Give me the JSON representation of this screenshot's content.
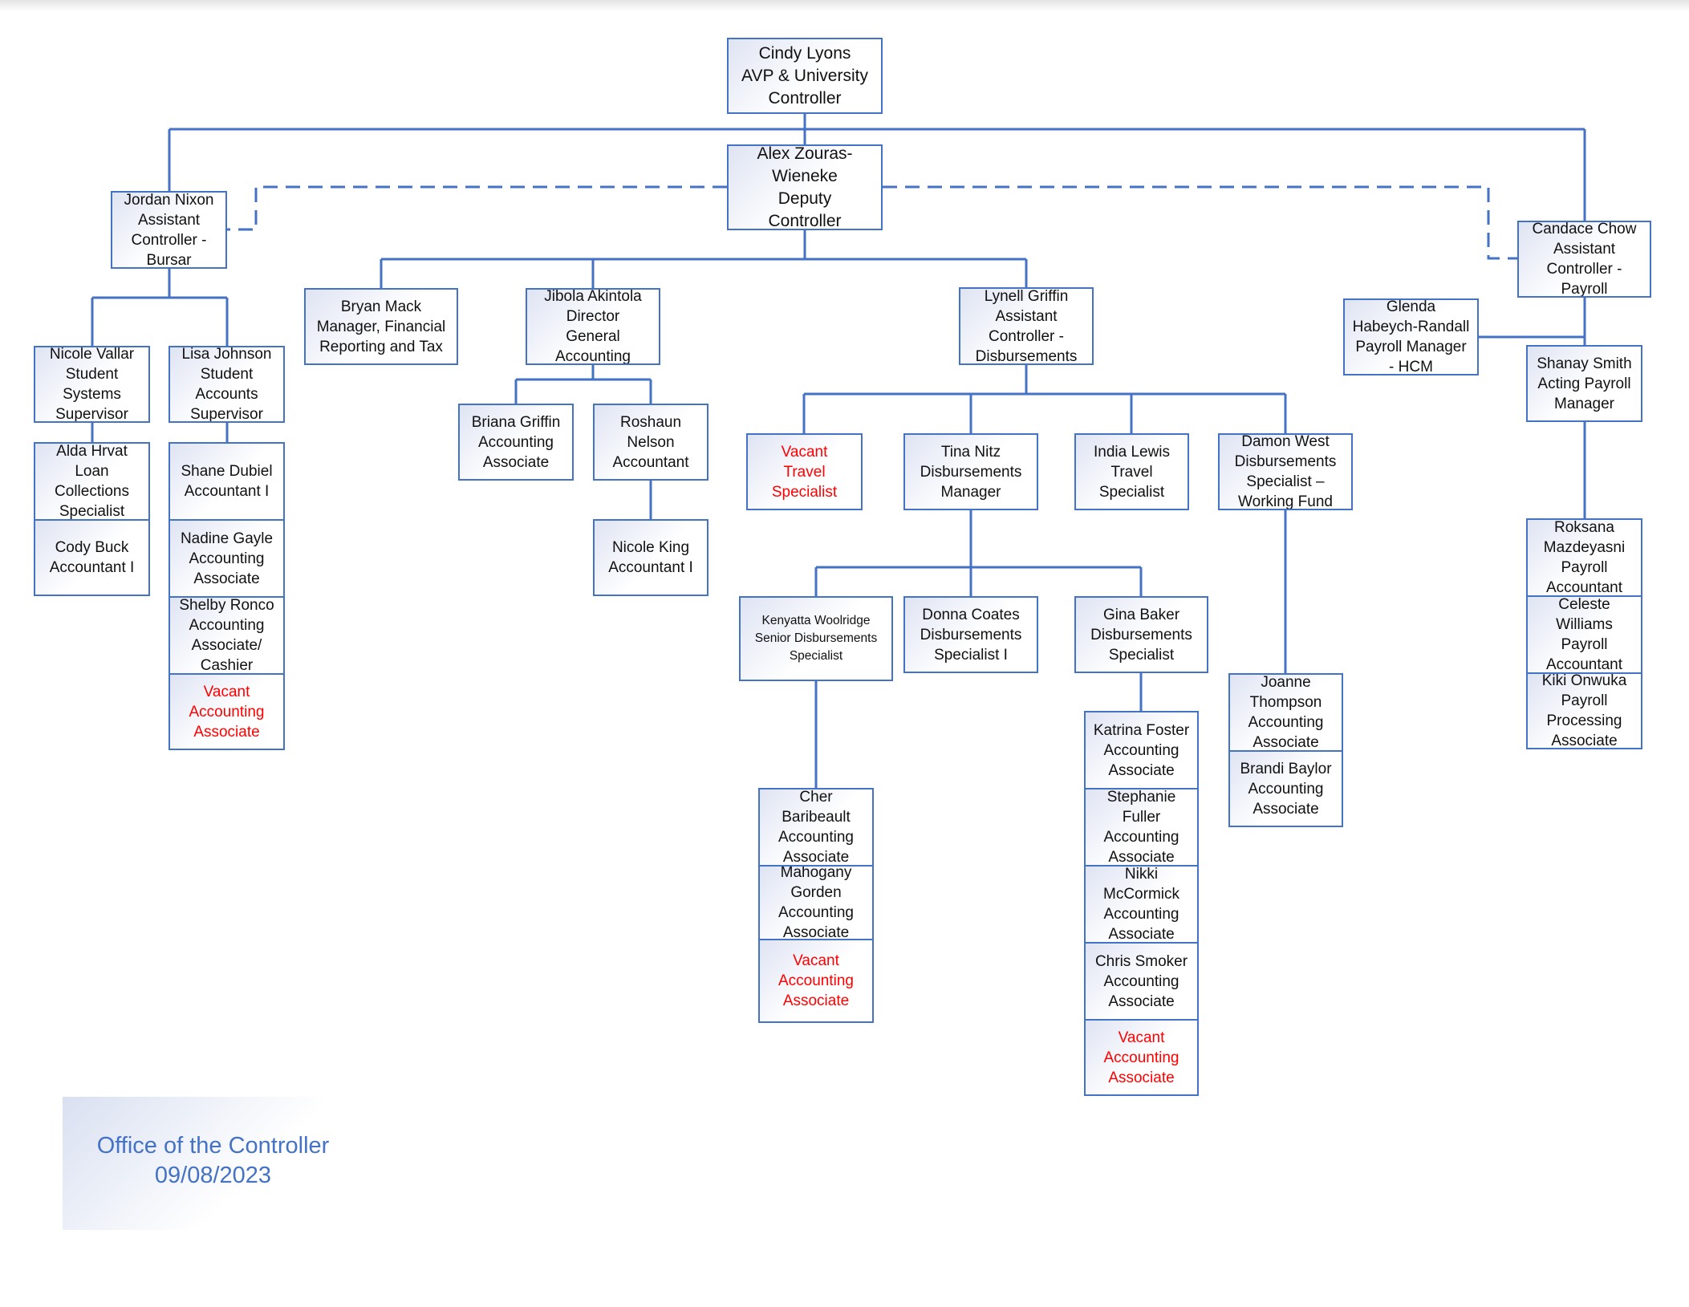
{
  "colors": {
    "line": "#4472c4",
    "border": "#4472c4",
    "vacant_text": "#ff0000",
    "footer_text": "#4472c4"
  },
  "nodes": {
    "cindy": [
      "Cindy Lyons",
      "AVP & University",
      "Controller"
    ],
    "alex": [
      "Alex Zouras-",
      "Wieneke",
      "Deputy",
      "Controller"
    ],
    "jordan": [
      "Jordan Nixon",
      "Assistant",
      "Controller -",
      "Bursar"
    ],
    "candace": [
      "Candace Chow",
      "Assistant",
      "Controller -",
      "Payroll"
    ],
    "glenda": [
      "Glenda",
      "Habeych-Randall",
      "Payroll Manager",
      "- HCM"
    ],
    "shanay": [
      "Shanay Smith",
      "Acting Payroll",
      "Manager"
    ],
    "nicole_vallar": [
      "Nicole Vallar",
      "Student",
      "Systems",
      "Supervisor"
    ],
    "lisa": [
      "Lisa Johnson",
      "Student",
      "Accounts",
      "Supervisor"
    ],
    "alda": [
      "Alda Hrvat",
      "Loan",
      "Collections",
      "Specialist"
    ],
    "cody": [
      "Cody Buck",
      "Accountant I"
    ],
    "shane": [
      "Shane Dubiel",
      "Accountant I"
    ],
    "nadine": [
      "Nadine Gayle",
      "Accounting",
      "Associate"
    ],
    "shelby": [
      "Shelby Ronco",
      "Accounting",
      "Associate/",
      "Cashier"
    ],
    "vacant_bursar": [
      "Vacant",
      "Accounting",
      "Associate"
    ],
    "bryan": [
      "Bryan Mack",
      "Manager, Financial",
      "Reporting and Tax"
    ],
    "jibola": [
      "Jibola Akintola",
      "Director",
      "General",
      "Accounting"
    ],
    "briana": [
      "Briana Griffin",
      "Accounting",
      "Associate"
    ],
    "roshaun": [
      "Roshaun",
      "Nelson",
      "Accountant"
    ],
    "nicole_king": [
      "Nicole King",
      "Accountant I"
    ],
    "lynell": [
      "Lynell Griffin",
      "Assistant",
      "Controller -",
      "Disbursements"
    ],
    "vacant_travel": [
      "Vacant",
      "Travel",
      "Specialist"
    ],
    "tina": [
      "Tina Nitz",
      "Disbursements",
      "Manager"
    ],
    "india": [
      "India Lewis",
      "Travel",
      "Specialist"
    ],
    "damon": [
      "Damon West",
      "Disbursements",
      "Specialist –",
      "Working Fund"
    ],
    "kenyatta": [
      "Kenyatta Woolridge",
      "Senior Disbursements",
      "Specialist"
    ],
    "donna": [
      "Donna Coates",
      "Disbursements",
      "Specialist I"
    ],
    "gina": [
      "Gina Baker",
      "Disbursements",
      "Specialist"
    ],
    "cher": [
      "Cher",
      "Baribeault",
      "Accounting",
      "Associate"
    ],
    "mahogany": [
      "Mahogany",
      "Gorden",
      "Accounting",
      "Associate"
    ],
    "vacant_kenyatta": [
      "Vacant",
      "Accounting",
      "Associate"
    ],
    "katrina": [
      "Katrina Foster",
      "Accounting",
      "Associate"
    ],
    "stephanie": [
      "Stephanie",
      "Fuller",
      "Accounting",
      "Associate"
    ],
    "nikki": [
      "Nikki",
      "McCormick",
      "Accounting",
      "Associate"
    ],
    "chris": [
      "Chris Smoker",
      "Accounting",
      "Associate"
    ],
    "vacant_gina": [
      "Vacant",
      "Accounting",
      "Associate"
    ],
    "joanne": [
      "Joanne",
      "Thompson",
      "Accounting",
      "Associate"
    ],
    "brandi": [
      "Brandi Baylor",
      "Accounting",
      "Associate"
    ],
    "roksana": [
      "Roksana",
      "Mazdeyasni",
      "Payroll",
      "Accountant"
    ],
    "celeste": [
      "Celeste",
      "Williams",
      "Payroll",
      "Accountant"
    ],
    "kiki": [
      "Kiki Onwuka",
      "Payroll",
      "Processing",
      "Associate"
    ]
  },
  "footer": {
    "title": "Office of the Controller",
    "date": "09/08/2023"
  }
}
